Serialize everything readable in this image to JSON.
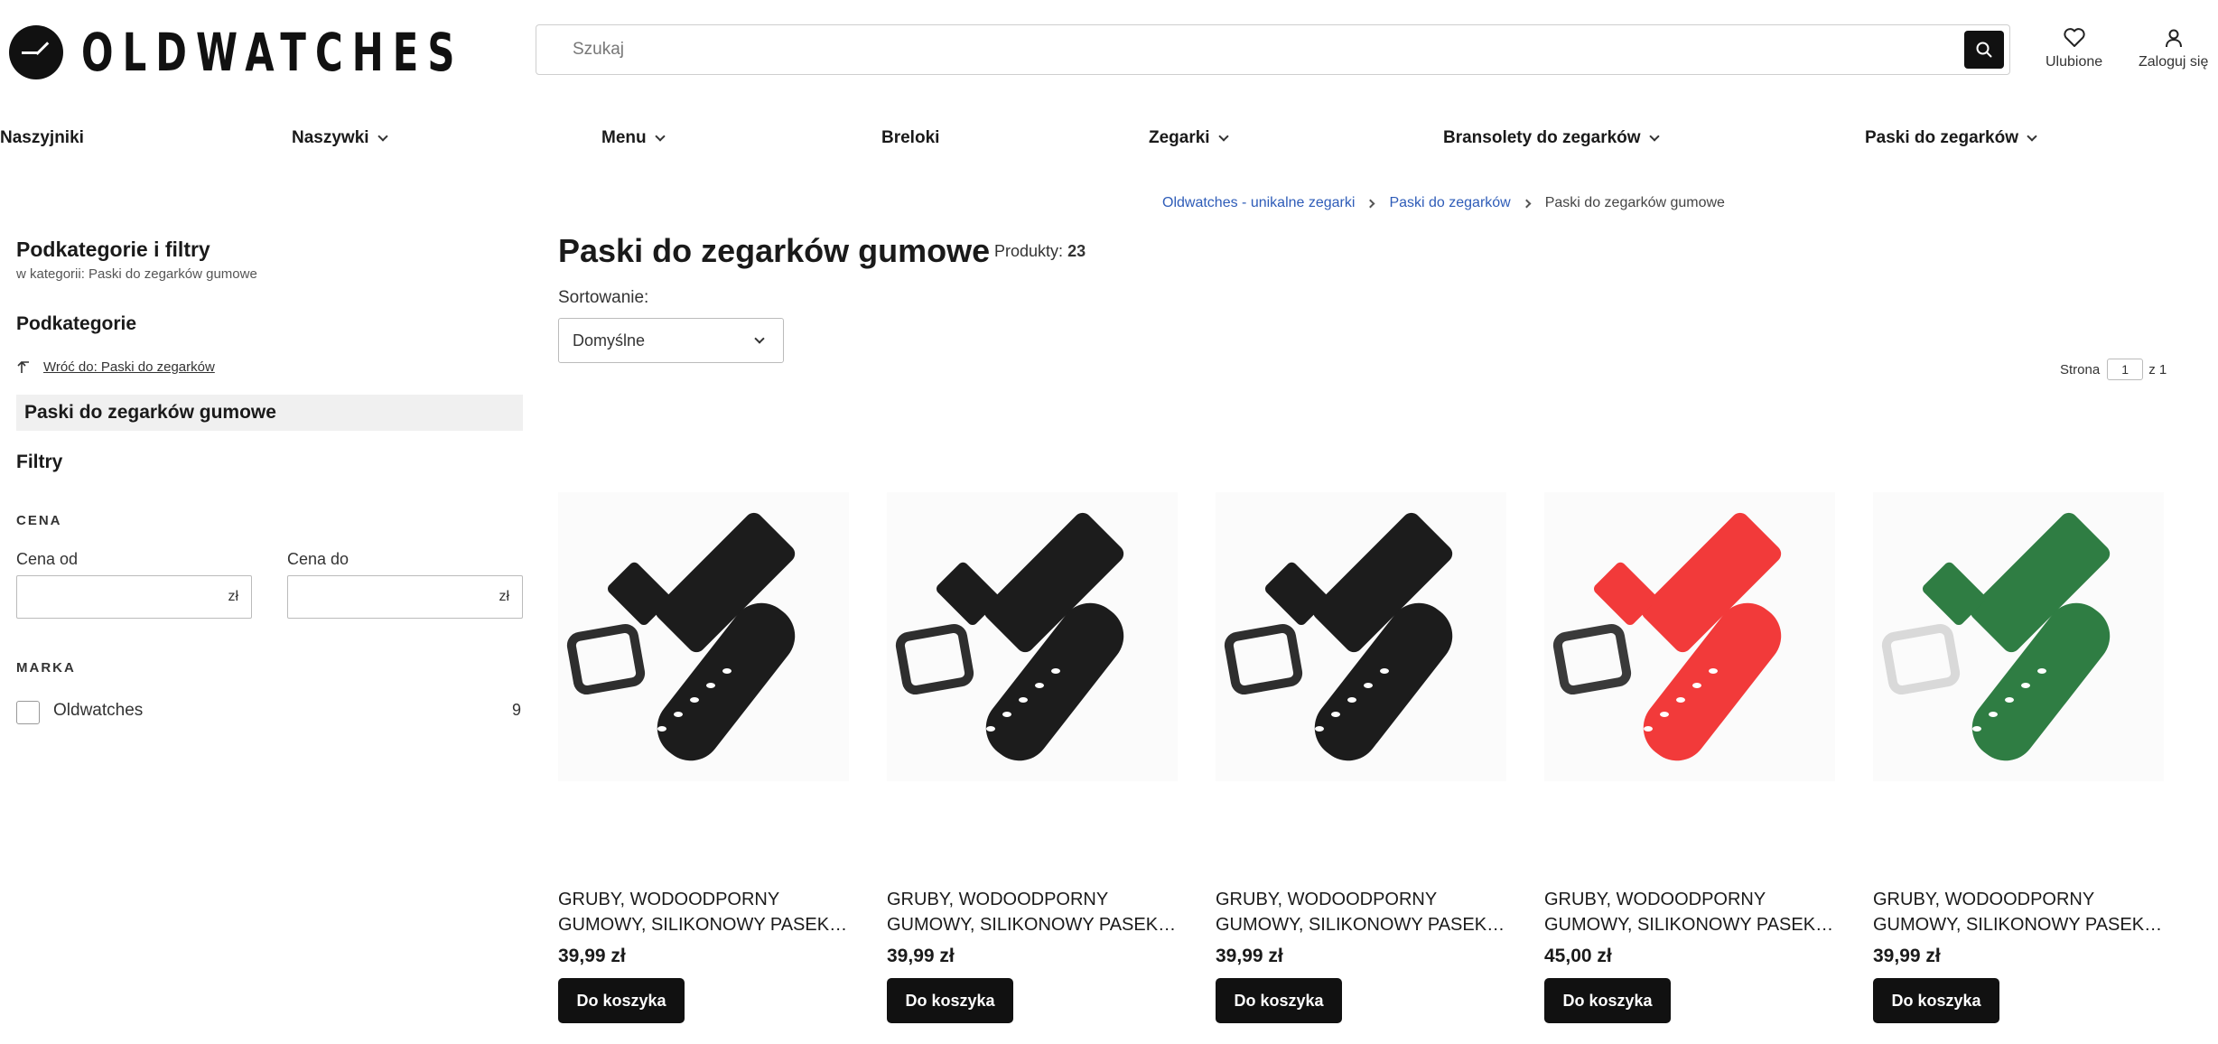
{
  "header": {
    "logo_text": "OLDWATCHES",
    "search_placeholder": "Szukaj",
    "favorites_label": "Ulubione",
    "login_label": "Zaloguj się"
  },
  "nav": {
    "items": [
      {
        "label": "Naszyjniki",
        "has_dropdown": false
      },
      {
        "label": "Naszywki",
        "has_dropdown": true
      },
      {
        "label": "Menu",
        "has_dropdown": true
      },
      {
        "label": "Breloki",
        "has_dropdown": false
      },
      {
        "label": "Zegarki",
        "has_dropdown": true
      },
      {
        "label": "Bransolety do zegarków",
        "has_dropdown": true
      },
      {
        "label": "Paski do zegarków",
        "has_dropdown": true
      }
    ]
  },
  "breadcrumb": {
    "items": [
      "Oldwatches - unikalne zegarki",
      "Paski do zegarków",
      "Paski do zegarków gumowe"
    ]
  },
  "sidebar": {
    "title": "Podkategorie i filtry",
    "subtitle": "w kategorii: Paski do zegarków gumowe",
    "subcategories_heading": "Podkategorie",
    "back_link": "Wróć do: Paski do zegarków",
    "active_category": "Paski do zegarków gumowe",
    "filters_heading": "Filtry",
    "price_section": "CENA",
    "price_from_label": "Cena od",
    "price_to_label": "Cena do",
    "currency": "zł",
    "brand_section": "MARKA",
    "brand_name": "Oldwatches",
    "brand_count": "9"
  },
  "main": {
    "title": "Paski do zegarków gumowe",
    "products_label": "Produkty:",
    "products_count": "23",
    "sort_label": "Sortowanie:",
    "sort_value": "Domyślne",
    "page_label": "Strona",
    "page_current": "1",
    "page_total": "z 1"
  },
  "products": [
    {
      "name_line1": "GRUBY, WODOODPORNY",
      "name_line2": "GUMOWY, SILIKONOWY PASEK DO ZEGARKA",
      "price": "39,99 zł",
      "button": "Do koszyka",
      "strap_color": "#1c1c1c",
      "buckle_color": "#2e2e2e"
    },
    {
      "name_line1": "GRUBY, WODOODPORNY",
      "name_line2": "GUMOWY, SILIKONOWY PASEK DO ZEGARKA",
      "price": "39,99 zł",
      "button": "Do koszyka",
      "strap_color": "#1c1c1c",
      "buckle_color": "#2e2e2e"
    },
    {
      "name_line1": "GRUBY, WODOODPORNY",
      "name_line2": "GUMOWY, SILIKONOWY PASEK DO ZEGARKA",
      "price": "39,99 zł",
      "button": "Do koszyka",
      "strap_color": "#1c1c1c",
      "buckle_color": "#2e2e2e"
    },
    {
      "name_line1": "GRUBY, WODOODPORNY",
      "name_line2": "GUMOWY, SILIKONOWY PASEK DO ZEGARKA",
      "price": "45,00 zł",
      "button": "Do koszyka",
      "strap_color": "#f23a3a",
      "buckle_color": "#3a3a3a"
    },
    {
      "name_line1": "GRUBY, WODOODPORNY",
      "name_line2": "GUMOWY, SILIKONOWY PASEK DO ZEGARKA",
      "price": "39,99 zł",
      "button": "Do koszyka",
      "strap_color": "#2f7d43",
      "buckle_color": "#d9d9d9"
    }
  ]
}
